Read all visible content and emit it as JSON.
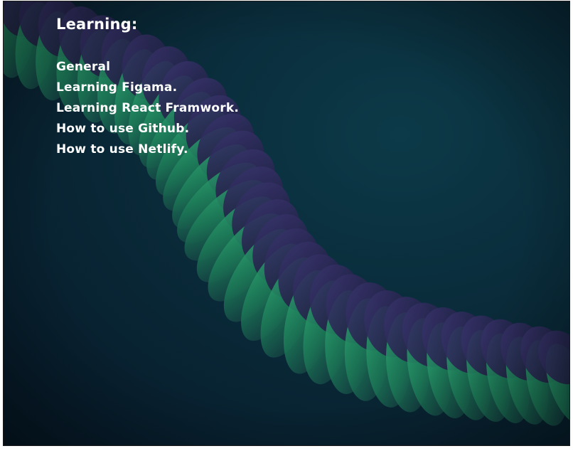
{
  "page": {
    "title": "Learning:",
    "items": [
      {
        "label": "General"
      },
      {
        "label": "Learning Figama."
      },
      {
        "label": "Learning React Framwork."
      },
      {
        "label": "How to use Github."
      },
      {
        "label": "How to use Netlify."
      }
    ]
  },
  "colors": {
    "background": "#0a2c3b",
    "ribbon_green": "#1f8a5e",
    "ribbon_purple": "#2c2a55",
    "text": "#ffffff"
  },
  "wallpaper": {
    "icon": "abstract-ribbon-wave"
  }
}
